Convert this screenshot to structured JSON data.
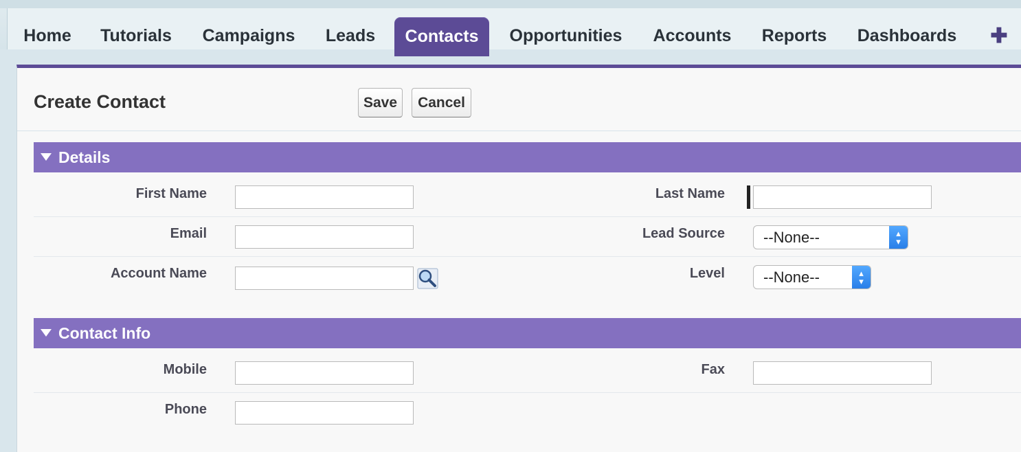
{
  "tabs": [
    {
      "label": "Home"
    },
    {
      "label": "Tutorials"
    },
    {
      "label": "Campaigns"
    },
    {
      "label": "Leads"
    },
    {
      "label": "Contacts",
      "active": true
    },
    {
      "label": "Opportunities"
    },
    {
      "label": "Accounts"
    },
    {
      "label": "Reports"
    },
    {
      "label": "Dashboards"
    },
    {
      "label": "✚"
    }
  ],
  "page": {
    "title": "Create Contact",
    "save_label": "Save",
    "cancel_label": "Cancel"
  },
  "sections": {
    "details": {
      "title": "Details",
      "first_name_label": "First Name",
      "last_name_label": "Last Name",
      "email_label": "Email",
      "lead_source_label": "Lead Source",
      "lead_source_value": "--None--",
      "account_name_label": "Account Name",
      "level_label": "Level",
      "level_value": "--None--"
    },
    "contact_info": {
      "title": "Contact Info",
      "mobile_label": "Mobile",
      "fax_label": "Fax",
      "phone_label": "Phone"
    }
  },
  "colors": {
    "accent": "#5c4b96",
    "section_header": "#8470c0",
    "select_arrow": "#2a7fe8"
  },
  "icons": {
    "lookup": "magnifier-lookup-icon",
    "section_toggle": "triangle-down-icon",
    "more_tabs": "plus-icon"
  }
}
